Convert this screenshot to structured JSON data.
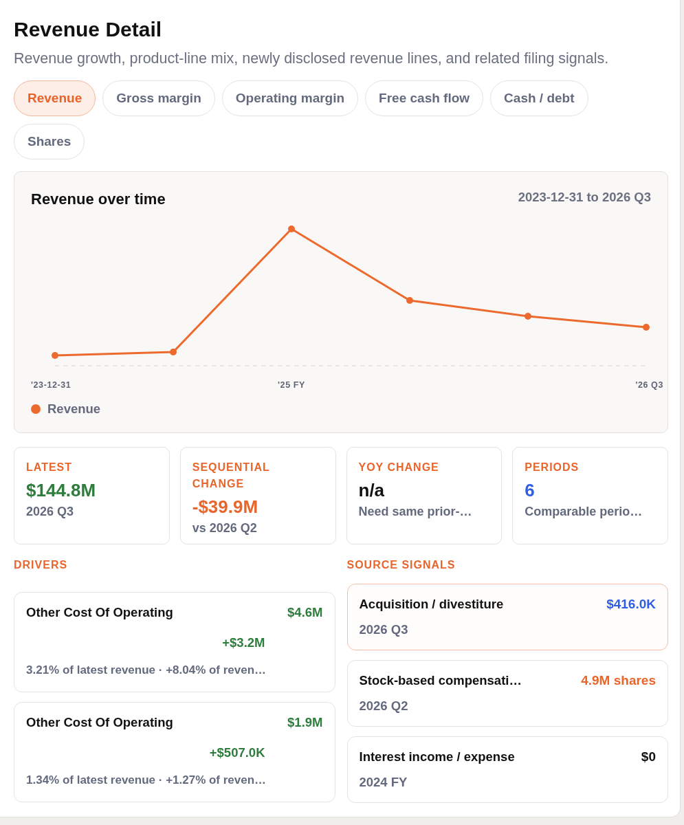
{
  "header": {
    "title": "Revenue Detail",
    "subtitle": "Revenue growth, product-line mix, newly disclosed revenue lines, and related filing signals."
  },
  "tabs": [
    {
      "label": "Revenue",
      "selected": true
    },
    {
      "label": "Gross margin",
      "selected": false
    },
    {
      "label": "Operating margin",
      "selected": false
    },
    {
      "label": "Free cash flow",
      "selected": false
    },
    {
      "label": "Cash / debt",
      "selected": false
    },
    {
      "label": "Shares",
      "selected": false
    }
  ],
  "chart_panel": {
    "title": "Revenue over time",
    "range": "2023-12-31 to 2026 Q3",
    "x_labels": [
      "'23-12-31",
      "'25 FY",
      "'26 Q3"
    ],
    "legend": [
      {
        "label": "Revenue",
        "color": "#ec6a2e"
      }
    ]
  },
  "stats": [
    {
      "label": "LATEST",
      "value": "$144.8M",
      "color": "#2f7d3c",
      "note": "2026 Q3"
    },
    {
      "label": "SEQUENTIAL CHANGE",
      "value": "-$39.9M",
      "color": "#e8652c",
      "note": "vs 2026 Q2"
    },
    {
      "label": "YOY CHANGE",
      "value": "n/a",
      "color": "#111111",
      "note": "Need same prior-…"
    },
    {
      "label": "PERIODS",
      "value": "6",
      "color": "#2f5ee6",
      "note": "Comparable perio…"
    }
  ],
  "drivers": {
    "heading": "DRIVERS",
    "items": [
      {
        "name": "Other Cost Of Operating",
        "value": "$4.6M",
        "change": "+$3.2M",
        "detail": "3.21% of latest revenue · +8.04% of reven…"
      },
      {
        "name": "Other Cost Of Operating",
        "value": "$1.9M",
        "change": "+$507.0K",
        "detail": "1.34% of latest revenue · +1.27% of reven…"
      }
    ]
  },
  "source_signals": {
    "heading": "SOURCE SIGNALS",
    "items": [
      {
        "name": "Acquisition / divestiture",
        "value": "$416.0K",
        "color": "#2f5ee6",
        "period": "2026 Q3",
        "selected": true
      },
      {
        "name": "Stock-based compensati…",
        "value": "4.9M shares",
        "color": "#e8652c",
        "period": "2026 Q2",
        "selected": false
      },
      {
        "name": "Interest income / expense",
        "value": "$0",
        "color": "#111111",
        "period": "2024 FY",
        "selected": false
      }
    ]
  }
}
